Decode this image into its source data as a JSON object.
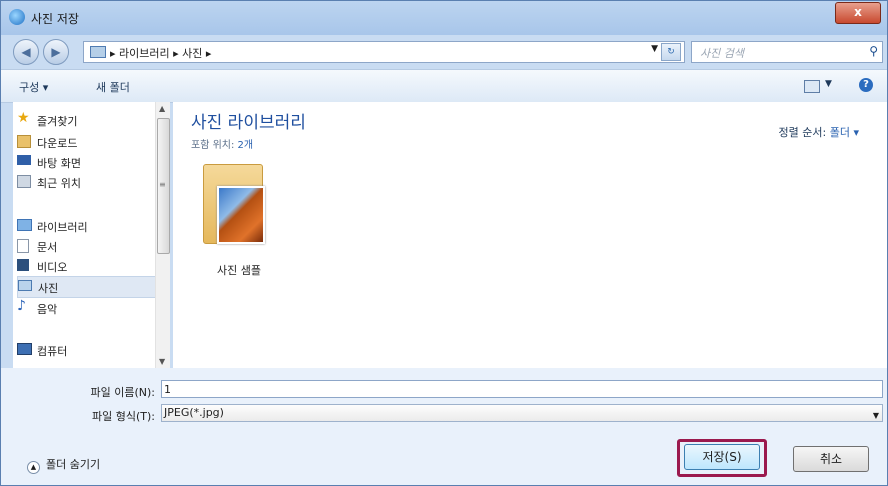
{
  "window": {
    "title": "사진 저장",
    "close_label": "x"
  },
  "nav": {
    "breadcrumb": [
      "라이브러리",
      "사진"
    ],
    "search_placeholder": "사진 검색"
  },
  "toolbar": {
    "organize": "구성 ▾",
    "new_folder": "새 폴더"
  },
  "sidebar": {
    "items": [
      {
        "label": "즐겨찾기",
        "icon": "star-icon"
      },
      {
        "label": "다운로드",
        "icon": "download-folder-icon"
      },
      {
        "label": "바탕 화면",
        "icon": "desktop-icon"
      },
      {
        "label": "최근 위치",
        "icon": "recent-places-icon"
      },
      {
        "label": "라이브러리",
        "icon": "library-icon"
      },
      {
        "label": "문서",
        "icon": "document-icon"
      },
      {
        "label": "비디오",
        "icon": "video-icon"
      },
      {
        "label": "사진",
        "icon": "pictures-icon",
        "selected": true
      },
      {
        "label": "음악",
        "icon": "music-icon"
      },
      {
        "label": "컴퓨터",
        "icon": "computer-icon"
      }
    ]
  },
  "main": {
    "title": "사진 라이브러리",
    "subtitle_prefix": "포함 위치:",
    "subtitle_count": "2개",
    "sort_label": "정렬 순서:",
    "sort_value": "폴더 ▾",
    "items": [
      {
        "label": "사진 샘플"
      }
    ]
  },
  "form": {
    "filename_label": "파일 이름(N):",
    "filename_value": "1",
    "filetype_label": "파일 형식(T):",
    "filetype_value": "JPEG(*.jpg)"
  },
  "footer": {
    "hide_folders": "폴더 숨기기",
    "save": "저장(S)",
    "cancel": "취소"
  },
  "colors": {
    "accent": "#1f4f9f",
    "highlight": "#9b1a4e",
    "frame": "#c9dcf2"
  }
}
